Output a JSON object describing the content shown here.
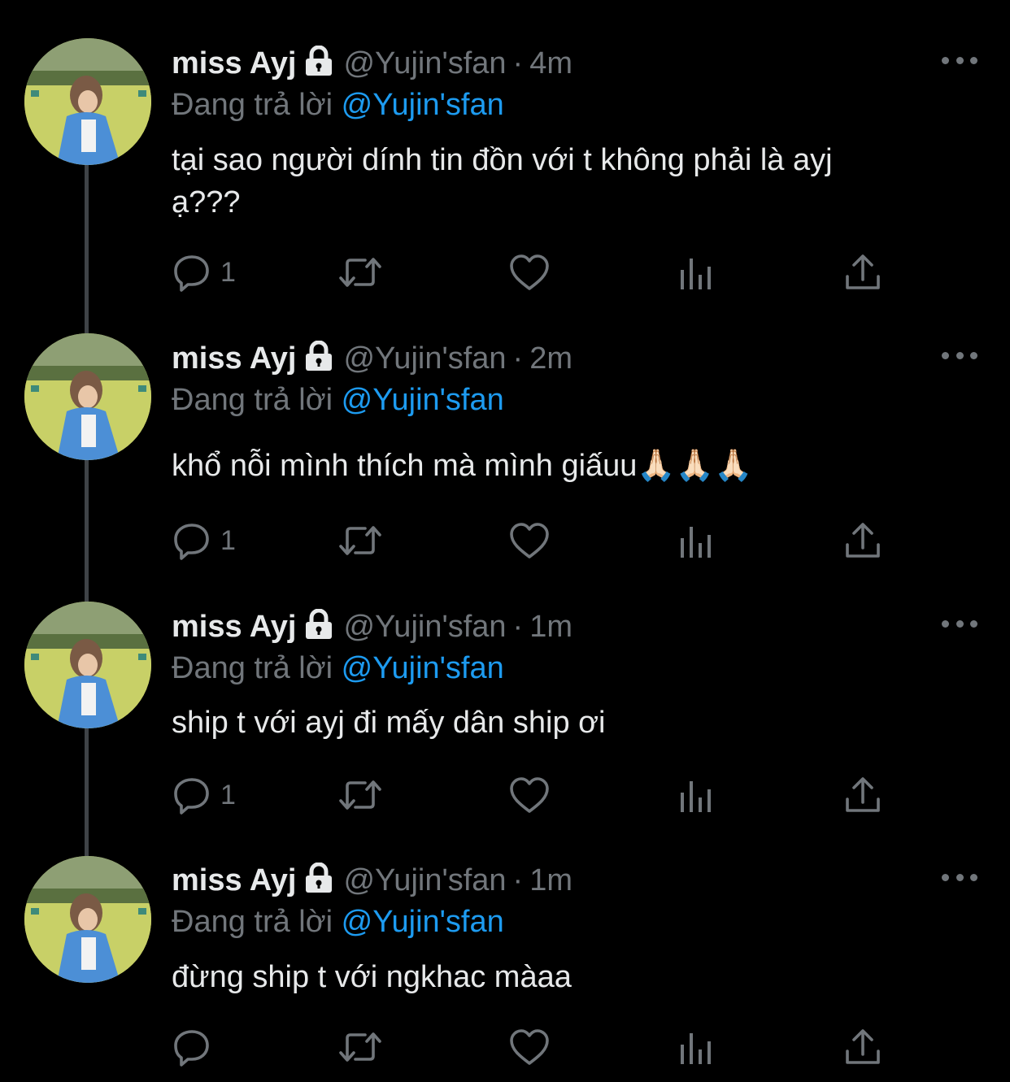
{
  "colors": {
    "background": "#000000",
    "text_primary": "#e7e9ea",
    "text_secondary": "#71767b",
    "mention": "#1d9bf0",
    "thread_line": "#3f4347"
  },
  "tweets": [
    {
      "name": "miss Ayj",
      "lock_icon": "lock-icon",
      "handle": "@Yujin'sfan",
      "separator": "·",
      "time": "4m",
      "replying_label": "Đang trả lời",
      "replying_to": "@Yujin'sfan",
      "text_lines": [
        "tại sao người dính tin đồn với t không phải là ayj",
        "ạ???"
      ],
      "reply_count": "1"
    },
    {
      "name": "miss Ayj",
      "lock_icon": "lock-icon",
      "handle": "@Yujin'sfan",
      "separator": "·",
      "time": "2m",
      "replying_label": "Đang trả lời",
      "replying_to": "@Yujin'sfan",
      "text_lines": [
        "khổ nỗi mình thích mà mình giấuu🙏🏻🙏🏻🙏🏻"
      ],
      "reply_count": "1"
    },
    {
      "name": "miss Ayj",
      "lock_icon": "lock-icon",
      "handle": "@Yujin'sfan",
      "separator": "·",
      "time": "1m",
      "replying_label": "Đang trả lời",
      "replying_to": "@Yujin'sfan",
      "text_lines": [
        "ship t với ayj đi mấy dân ship ơi"
      ],
      "reply_count": "1"
    },
    {
      "name": "miss Ayj",
      "lock_icon": "lock-icon",
      "handle": "@Yujin'sfan",
      "separator": "·",
      "time": "1m",
      "replying_label": "Đang trả lời",
      "replying_to": "@Yujin'sfan",
      "text_lines": [
        "đừng ship t với ngkhac màaa"
      ],
      "reply_count": ""
    }
  ],
  "action_icons": [
    "reply-icon",
    "retweet-icon",
    "like-icon",
    "analytics-icon",
    "share-icon"
  ],
  "more_icon": "more-options-icon"
}
